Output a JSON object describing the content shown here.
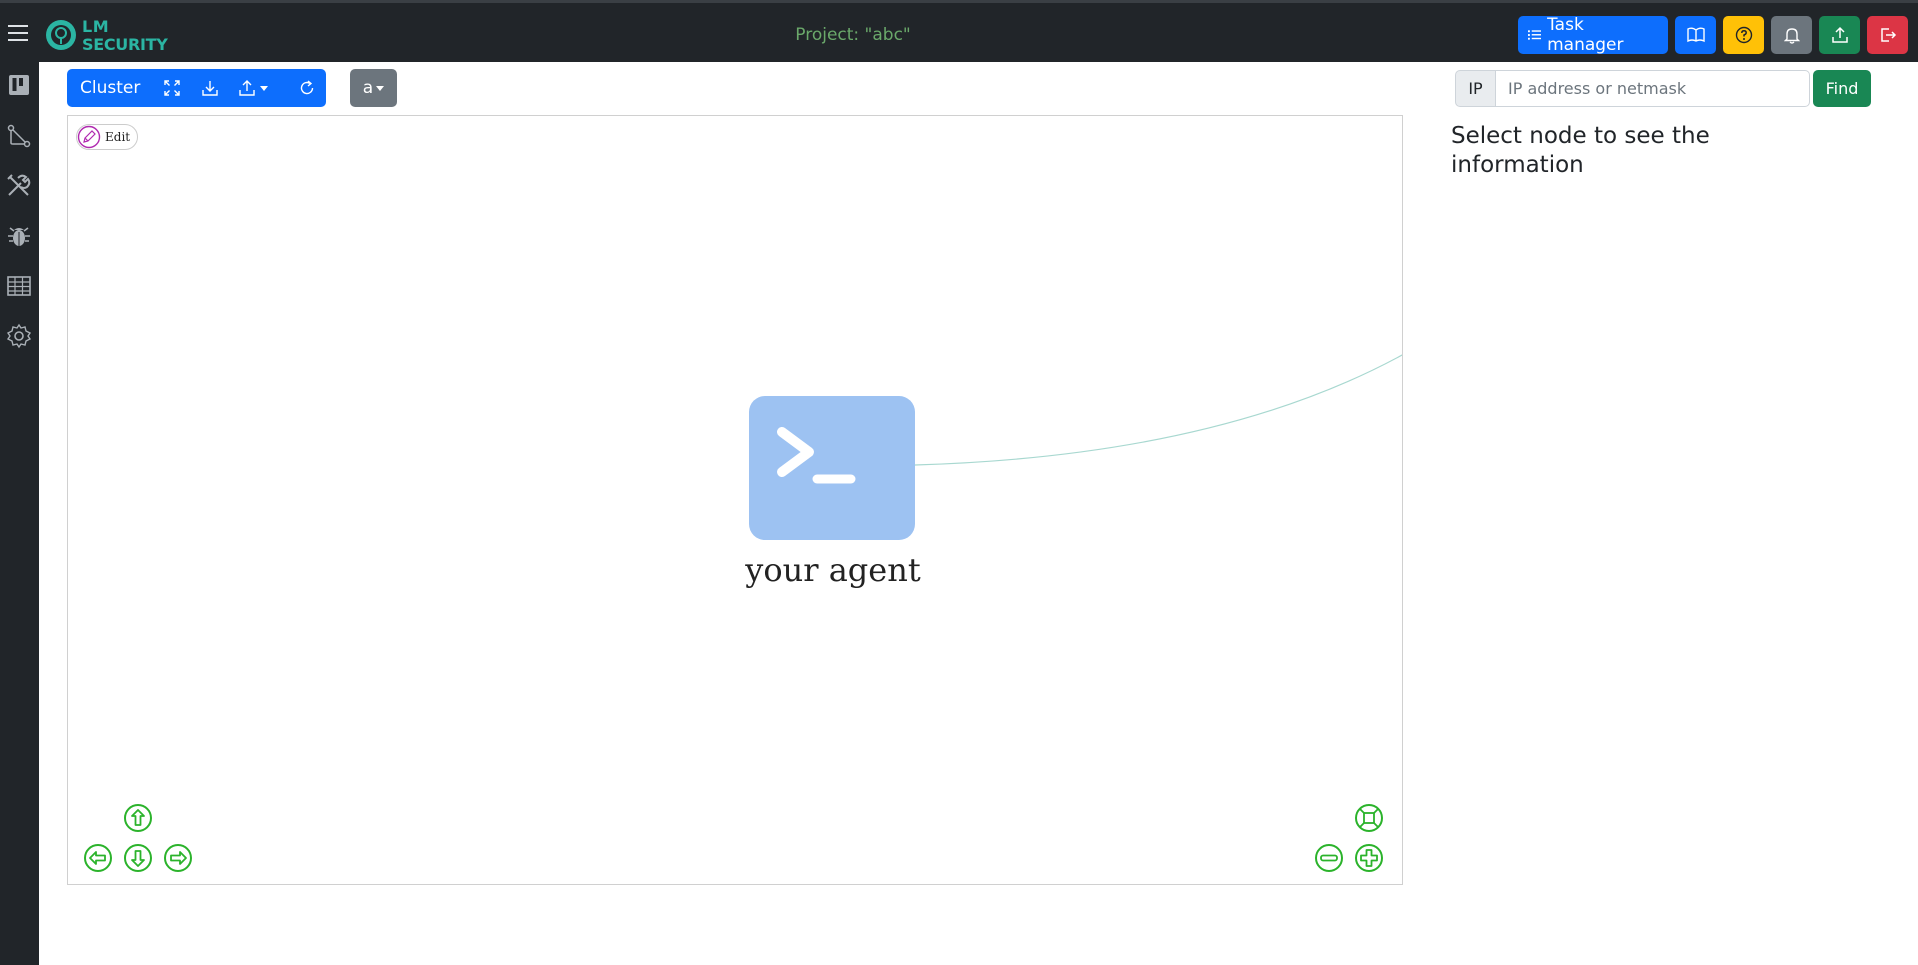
{
  "header": {
    "logo_line1": "LM",
    "logo_line2": "SECURITY",
    "project_title": "Project: \"abc\"",
    "task_manager_label": "Task manager",
    "buttons": [
      {
        "icon": "book-icon",
        "color": "#0d6efd"
      },
      {
        "icon": "help-icon",
        "color": "#ffc107"
      },
      {
        "icon": "bell-icon",
        "color": "#6c757d"
      },
      {
        "icon": "upload-icon",
        "color": "#198754"
      },
      {
        "icon": "logout-icon",
        "color": "#dc3545"
      }
    ]
  },
  "sidebar": {
    "items": [
      "board-icon",
      "graph-icon",
      "tools-icon",
      "bug-icon",
      "table-icon",
      "settings-icon"
    ]
  },
  "toolbar": {
    "cluster_label": "Cluster",
    "dropdown_value": "a"
  },
  "graph": {
    "edit_label": "Edit",
    "node_label": "your agent",
    "node_color": "#9dc2f2",
    "edge_color": "#a8d8d0"
  },
  "search": {
    "prefix": "IP",
    "placeholder": "IP address or netmask",
    "find_label": "Find"
  },
  "info_panel": {
    "message": "Select node to see the information"
  },
  "colors": {
    "nav_green": "#2bb32b",
    "primary": "#0d6efd"
  }
}
